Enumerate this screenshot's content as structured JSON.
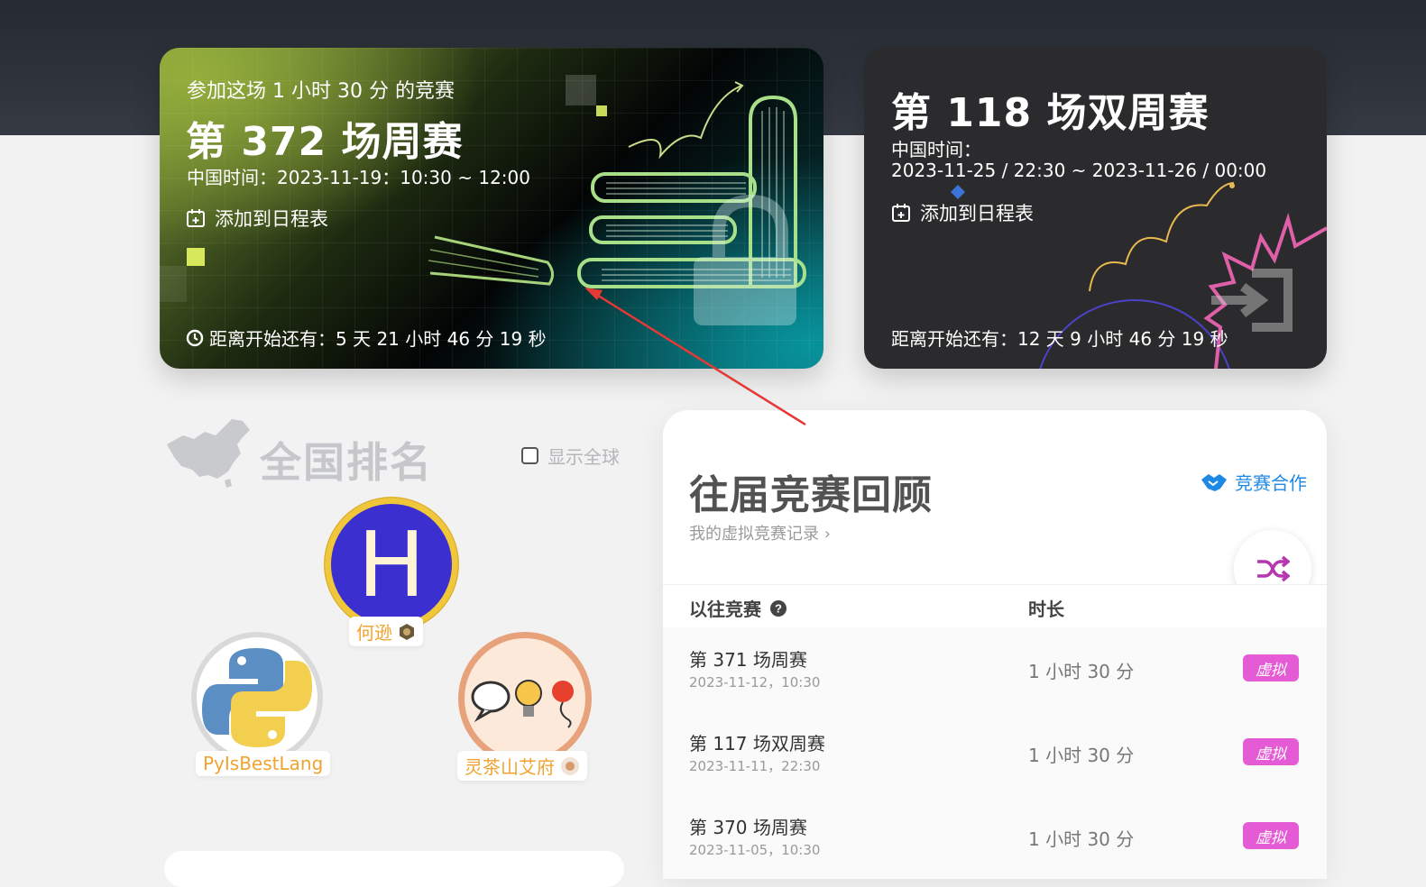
{
  "weekly": {
    "subtitle": "参加这场 1 小时 30 分 的竞赛",
    "title": "第 372 场周赛",
    "time": "中国时间：2023-11-19：10:30 ~ 12:00",
    "calendar": "添加到日程表",
    "countdown": "距离开始还有：5 天 21 小时 46 分 19 秒"
  },
  "biweekly": {
    "title": "第 118 场双周赛",
    "time_label": "中国时间：",
    "time_range": "2023-11-25 / 22:30 ~ 2023-11-26 / 00:00",
    "calendar": "添加到日程表",
    "countdown": "距离开始还有：12 天 9 小时 46 分 19 秒"
  },
  "ranking": {
    "title": "全国排名",
    "global_toggle": "显示全球",
    "users": [
      {
        "name": "何逊",
        "avatar_letter": "H"
      },
      {
        "name": "PyIsBestLang"
      },
      {
        "name": "灵茶山艾府"
      }
    ]
  },
  "past": {
    "heading": "往届竞赛回顾",
    "my_record": "我的虚拟竞赛记录 ›",
    "cooperation": "竞赛合作",
    "col_contest": "以往竞赛",
    "col_duration": "时长",
    "rows": [
      {
        "name": "第 371 场周赛",
        "date": "2023-11-12，10:30",
        "duration": "1 小时 30 分",
        "badge": "虚拟"
      },
      {
        "name": "第 117 场双周赛",
        "date": "2023-11-11，22:30",
        "duration": "1 小时 30 分",
        "badge": "虚拟"
      },
      {
        "name": "第 370 场周赛",
        "date": "2023-11-05，10:30",
        "duration": "1 小时 30 分",
        "badge": "虚拟"
      }
    ]
  },
  "colors": {
    "accent_blue": "#1e88e5",
    "virtual_badge": "#e55bd6",
    "gold": "#f0a32f"
  }
}
